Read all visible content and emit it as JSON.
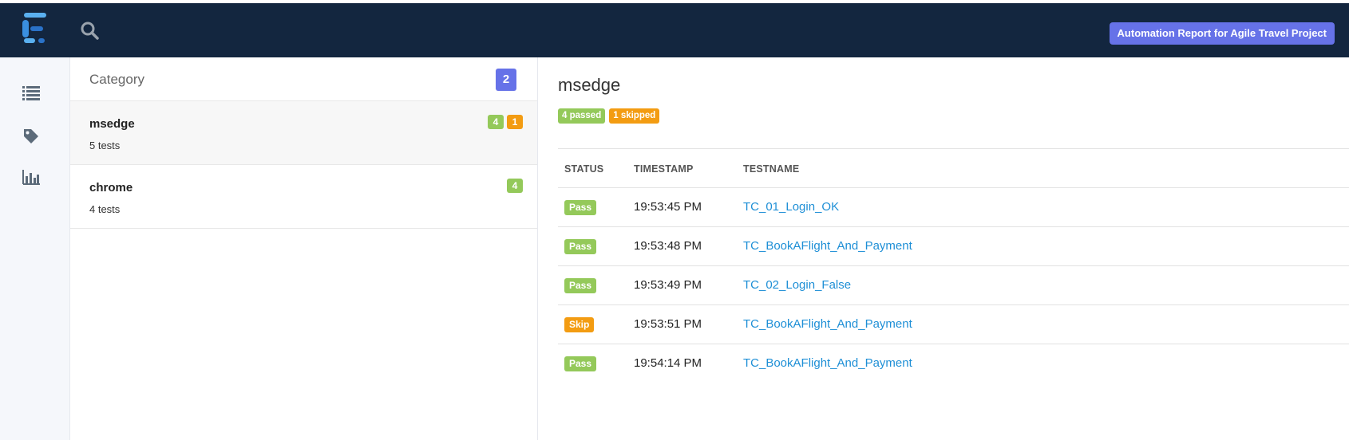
{
  "header": {
    "report_label": "Automation Report for Agile Travel Project",
    "logo_icon": "extent-logo-icon",
    "search_icon": "search-icon"
  },
  "sidebar": {
    "items": [
      {
        "icon": "list-icon"
      },
      {
        "icon": "tag-icon"
      },
      {
        "icon": "bar-chart-icon"
      }
    ]
  },
  "categories": {
    "title": "Category",
    "count": "2",
    "items": [
      {
        "name": "msedge",
        "tests": "5 tests",
        "passed": "4",
        "skipped": "1"
      },
      {
        "name": "chrome",
        "tests": "4 tests",
        "passed": "4"
      }
    ]
  },
  "detail": {
    "title": "msedge",
    "passed_label": "4 passed",
    "skipped_label": "1 skipped",
    "columns": [
      "STATUS",
      "TIMESTAMP",
      "TESTNAME"
    ],
    "rows": [
      {
        "status": "Pass",
        "time": "19:53:45 PM",
        "name": "TC_01_Login_OK"
      },
      {
        "status": "Pass",
        "time": "19:53:48 PM",
        "name": "TC_BookAFlight_And_Payment"
      },
      {
        "status": "Pass",
        "time": "19:53:49 PM",
        "name": "TC_02_Login_False"
      },
      {
        "status": "Skip",
        "time": "19:53:51 PM",
        "name": "TC_BookAFlight_And_Payment"
      },
      {
        "status": "Pass",
        "time": "19:54:14 PM",
        "name": "TC_BookAFlight_And_Payment"
      }
    ]
  },
  "colors": {
    "topbar": "#13263f",
    "accent": "#6672e8",
    "pass": "#94c95a",
    "skip": "#f39c12",
    "link": "#1e8fd6"
  }
}
